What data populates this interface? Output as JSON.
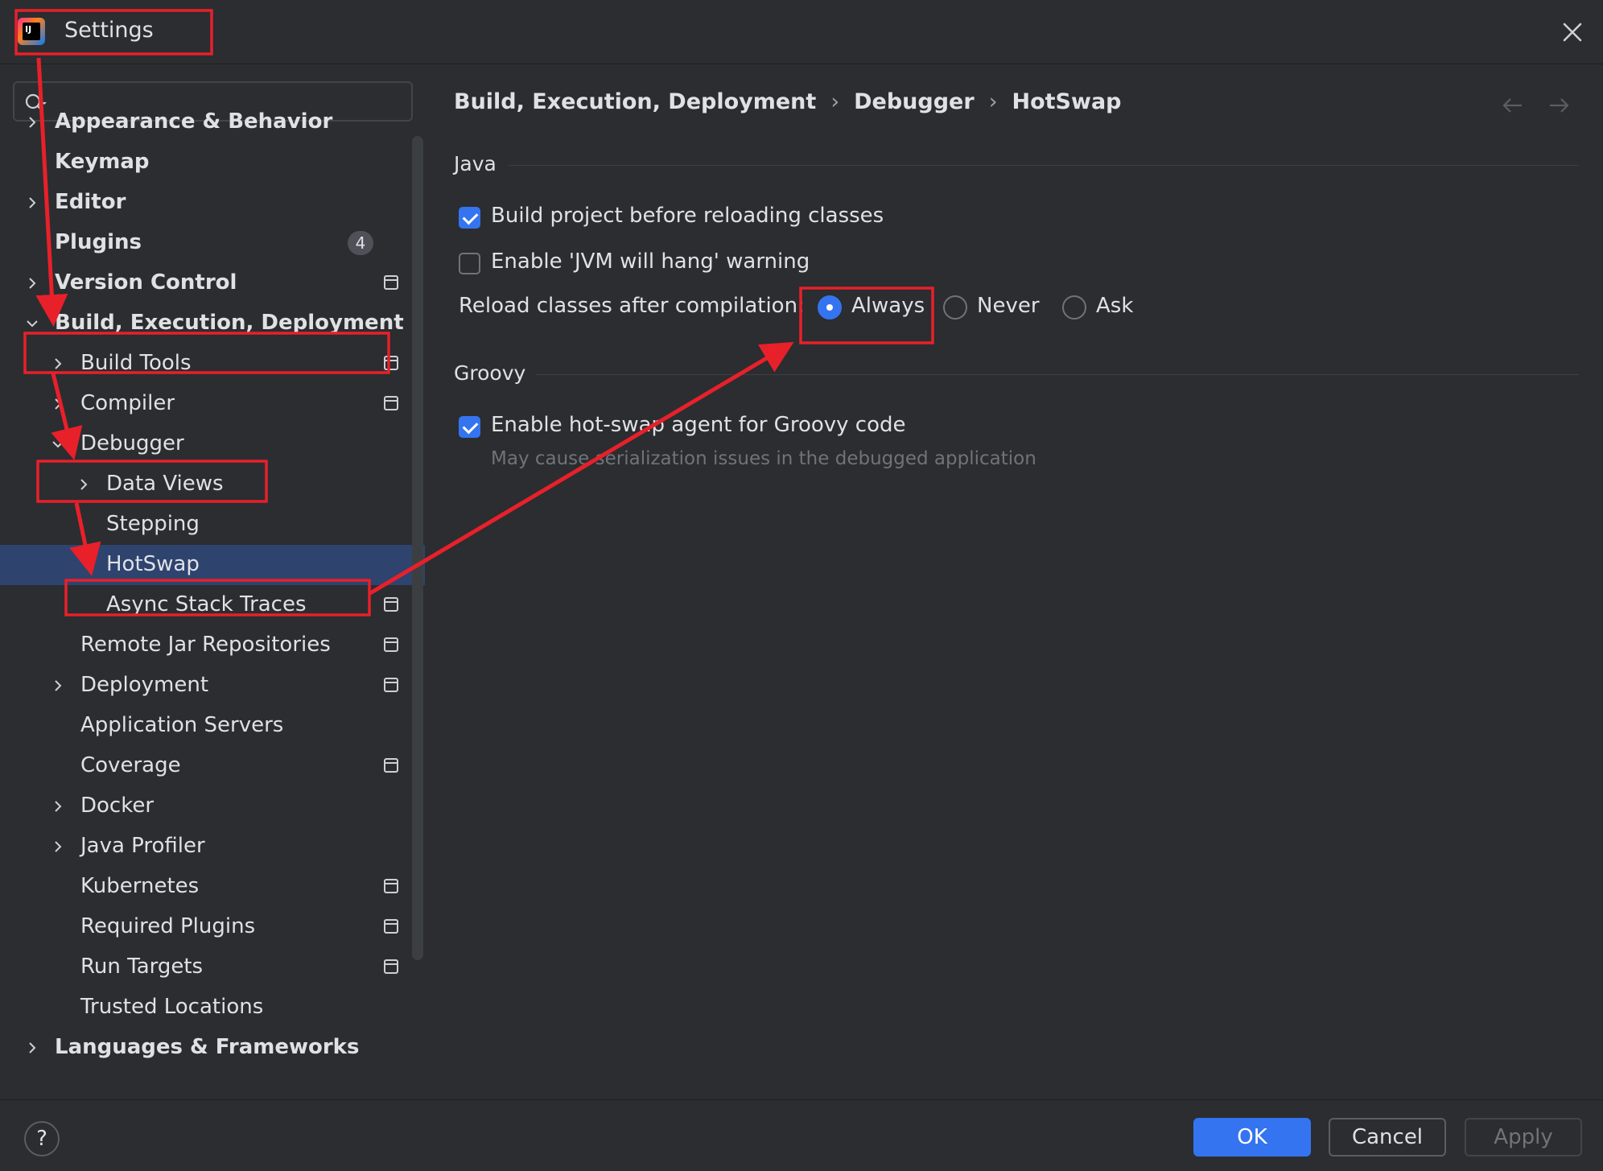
{
  "window": {
    "title": "Settings"
  },
  "search": {
    "placeholder": ""
  },
  "tree": {
    "appearance": "Appearance & Behavior",
    "keymap": "Keymap",
    "editor": "Editor",
    "plugins": "Plugins",
    "plugins_badge": "4",
    "version_control": "Version Control",
    "build": "Build, Execution, Deployment",
    "build_tools": "Build Tools",
    "compiler": "Compiler",
    "debugger": "Debugger",
    "data_views": "Data Views",
    "stepping": "Stepping",
    "hotswap": "HotSwap",
    "async_stack_traces": "Async Stack Traces",
    "remote_jar": "Remote Jar Repositories",
    "deployment": "Deployment",
    "app_servers": "Application Servers",
    "coverage": "Coverage",
    "docker": "Docker",
    "java_profiler": "Java Profiler",
    "kubernetes": "Kubernetes",
    "required_plugins": "Required Plugins",
    "run_targets": "Run Targets",
    "trusted_locations": "Trusted Locations",
    "languages": "Languages & Frameworks"
  },
  "breadcrumb": [
    "Build, Execution, Deployment",
    "Debugger",
    "HotSwap"
  ],
  "breadcrumb_sep": "›",
  "java": {
    "title": "Java",
    "build_before_reload": {
      "label": "Build project before reloading classes",
      "checked": true
    },
    "jvm_hang_warning": {
      "label": "Enable 'JVM will hang' warning",
      "checked": false
    },
    "reload_label": "Reload classes after compilation:",
    "reload_options": [
      "Always",
      "Never",
      "Ask"
    ],
    "reload_selected": "Always"
  },
  "groovy": {
    "title": "Groovy",
    "hotswap_agent": {
      "label": "Enable hot-swap agent for Groovy code",
      "checked": true
    },
    "hint": "May cause serialization issues in the debugged application"
  },
  "footer": {
    "help": "?",
    "ok": "OK",
    "cancel": "Cancel",
    "apply": "Apply"
  },
  "colors": {
    "background": "#2b2d30",
    "selection": "#2e436e",
    "accent": "#3574f0",
    "annotation": "#e8202a"
  }
}
